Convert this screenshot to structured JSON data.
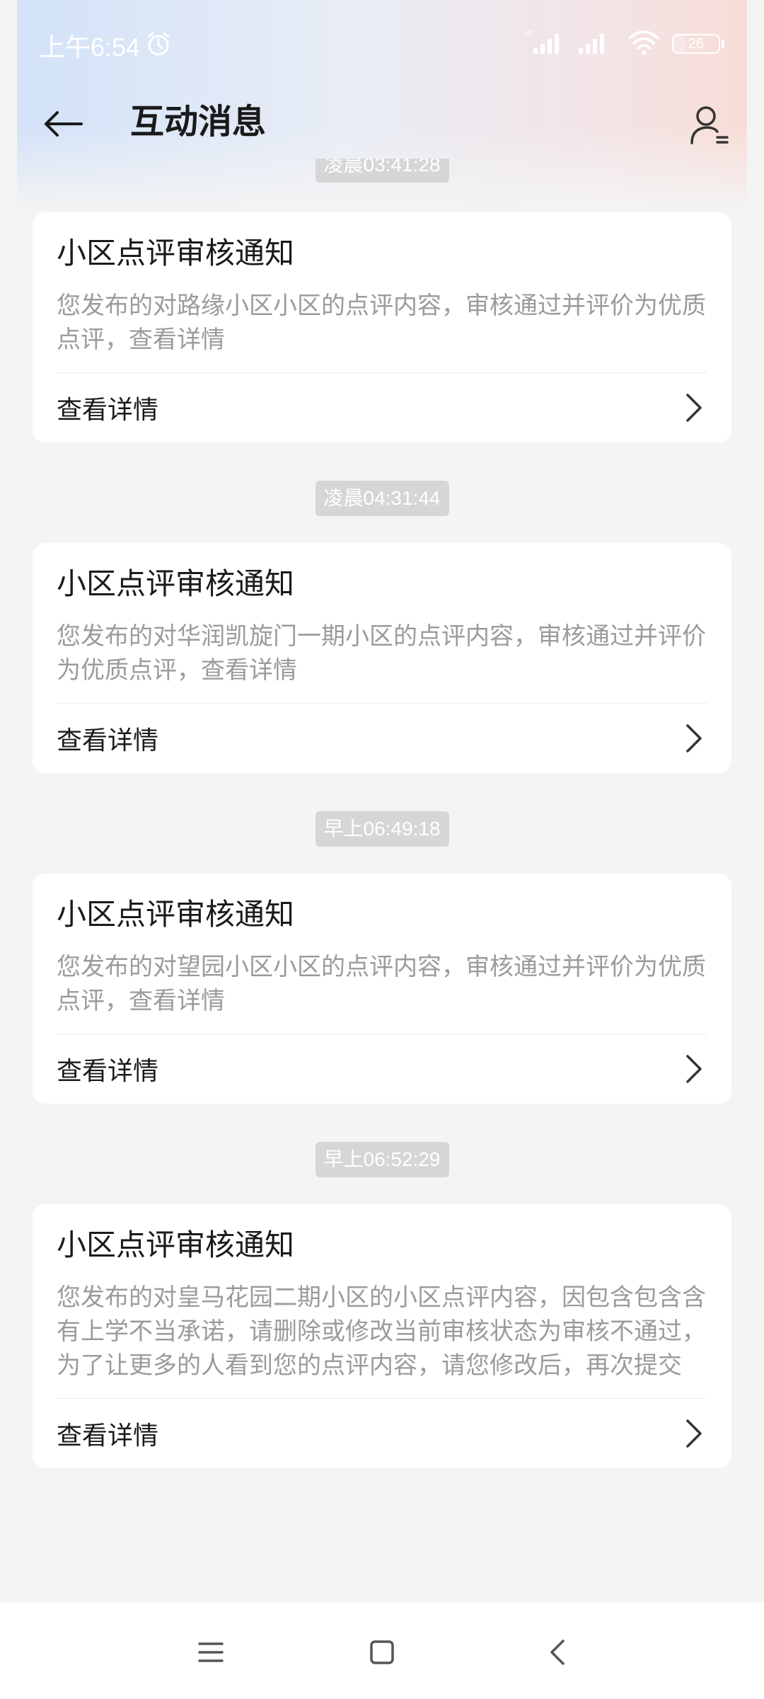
{
  "status_bar": {
    "time": "上午6:54",
    "battery_level": "26"
  },
  "header": {
    "title": "互动消息"
  },
  "messages": [
    {
      "time": "凌晨03:41:28",
      "title": "小区点评审核通知",
      "description": "您发布的对路缘小区小区的点评内容，审核通过并评价为优质点评，查看详情",
      "link_label": "查看详情"
    },
    {
      "time": "凌晨04:31:44",
      "title": "小区点评审核通知",
      "description": "您发布的对华润凯旋门一期小区的点评内容，审核通过并评价为优质点评，查看详情",
      "link_label": "查看详情"
    },
    {
      "time": "早上06:49:18",
      "title": "小区点评审核通知",
      "description": "您发布的对望园小区小区的点评内容，审核通过并评价为优质点评，查看详情",
      "link_label": "查看详情"
    },
    {
      "time": "早上06:52:29",
      "title": "小区点评审核通知",
      "description": "您发布的对皇马花园二期小区的小区点评内容，因包含包含含有上学不当承诺，请删除或修改当前审核状态为审核不通过，为了让更多的人看到您的点评内容，请您修改后，再次提交",
      "link_label": "查看详情"
    }
  ],
  "colors": {
    "chip_bg": "#d6d6d6",
    "card_bg": "#ffffff",
    "title_text": "#1a1a1a",
    "desc_text": "#9b9b9b"
  },
  "icons": {
    "back": "arrow-left-icon",
    "profile": "user-list-icon",
    "chevron": "chevron-right-icon",
    "nav_menu": "menu-icon",
    "nav_home": "home-square-icon",
    "nav_back": "back-triangle-icon"
  }
}
